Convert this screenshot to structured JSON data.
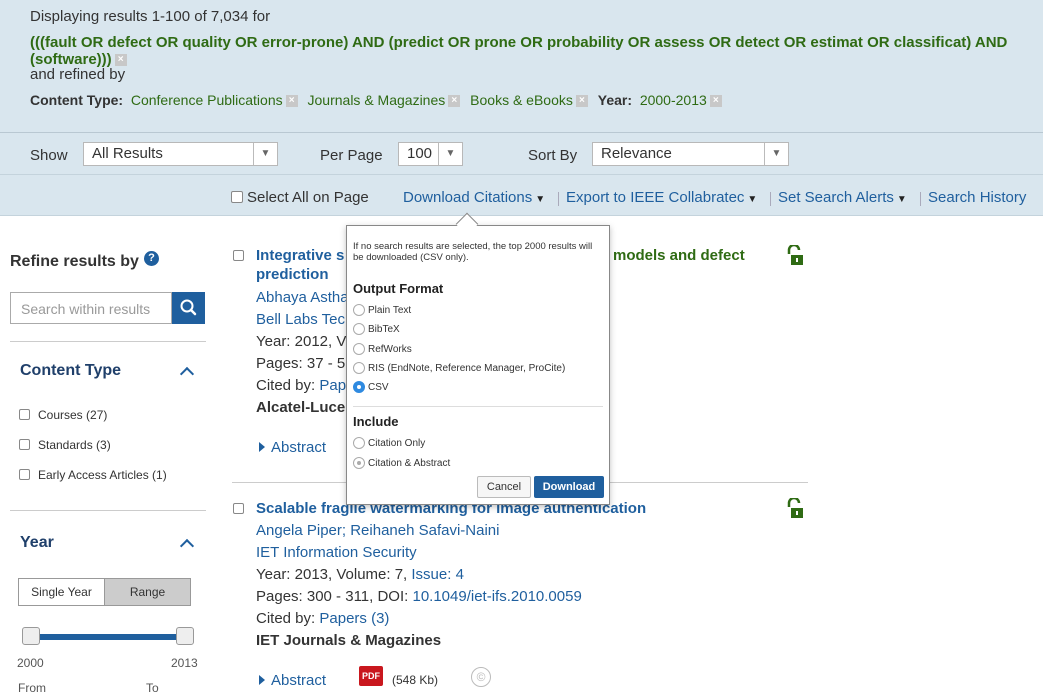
{
  "header": {
    "displaying": "Displaying results 1-100 of 7,034 for",
    "query": "(((fault OR defect OR quality OR error-prone) AND (predict OR prone OR probability OR assess OR detect OR estimat OR classificat) AND (software)))",
    "refined_by": "and refined by",
    "content_type_label": "Content Type:",
    "filters": [
      "Conference Publications",
      "Journals & Magazines",
      "Books & eBooks"
    ],
    "year_label": "Year:",
    "year_value": "2000-2013",
    "remove_glyph": "×"
  },
  "controls": {
    "show_label": "Show",
    "show_value": "All Results",
    "per_page_label": "Per Page",
    "per_page_value": "100",
    "sort_label": "Sort By",
    "sort_value": "Relevance"
  },
  "actions": {
    "select_all": "Select All on Page",
    "download_citations": "Download Citations",
    "export": "Export to IEEE Collabratec",
    "alerts": "Set Search Alerts",
    "history": "Search History"
  },
  "sidebar": {
    "refine_title": "Refine results by",
    "search_placeholder": "Search within results",
    "content_type_heading": "Content Type",
    "content_types": [
      "Courses (27)",
      "Standards (3)",
      "Early Access Articles (1)"
    ],
    "year_heading": "Year",
    "single_year": "Single Year",
    "range": "Range",
    "year_min": "2000",
    "year_max": "2013",
    "from_label": "From",
    "to_label": "To"
  },
  "results": [
    {
      "title_start": "Integrative s",
      "title_end_hl": "models and defect",
      "title_line2": "prediction",
      "authors": "Abhaya Astha",
      "publication": "Bell Labs Tec",
      "year_line": "Year: 2012, V",
      "pages_line": "Pages: 37 - 5",
      "cited_prefix": "Cited by: ",
      "cited_link": "Pap",
      "publisher": "Alcatel-Luce",
      "abstract": "Abstract"
    },
    {
      "title": "Scalable fragile watermarking for image authentication",
      "authors": "Angela Piper; Reihaneh Safavi-Naini",
      "publication": "IET Information Security",
      "year_prefix": "Year: 2013, Volume: 7, ",
      "issue": "Issue: 4",
      "pages_prefix": "Pages: 300 - 311, DOI: ",
      "doi": "10.1049/iet-ifs.2010.0059",
      "cited_prefix": "Cited by: ",
      "cited_link": "Papers (3)",
      "publisher": "IET Journals & Magazines",
      "abstract": "Abstract",
      "pdf_label": "PDF",
      "pdf_size": "(548 Kb)",
      "copyright": "©"
    }
  ],
  "popup": {
    "note": "If no search results are selected, the top 2000 results will be downloaded (CSV only).",
    "output_heading": "Output Format",
    "formats": [
      "Plain Text",
      "BibTeX",
      "RefWorks",
      "RIS (EndNote, Reference Manager, ProCite)",
      "CSV"
    ],
    "selected_format": "CSV",
    "include_heading": "Include",
    "include_options": [
      "Citation Only",
      "Citation & Abstract"
    ],
    "cancel": "Cancel",
    "download": "Download"
  },
  "colors": {
    "accent": "#1f5f9e",
    "query_green": "#2f6b14",
    "header_bg": "#d9e6ee"
  }
}
